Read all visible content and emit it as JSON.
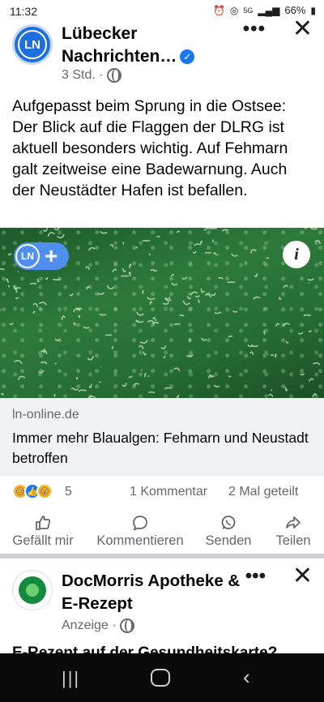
{
  "status_bar": {
    "time": "11:32",
    "network": "5G",
    "battery": "66%"
  },
  "post": {
    "avatar_text": "LN",
    "page_name": "Lübecker Nachrichten…",
    "time_ago": "3 Std. ·",
    "more_label": "•••",
    "close_label": "✕",
    "text": "Aufgepasst beim Sprung in die Ostsee: Der Blick auf die Flaggen der DLRG ist aktuell besonders wichtig. Auf Fehmarn galt zeitweise eine Badewarnung. Auch der Neustädter Hafen ist befallen.",
    "image_badge_text": "LN",
    "image_badge_plus": "+",
    "image_info_label": "i",
    "link_domain": "ln-online.de",
    "link_title": "Immer mehr Blaualgen: Fehmarn und Neustadt betroffen",
    "reaction_count": "5",
    "comments": "1 Kommentar",
    "shares": "2 Mal geteilt"
  },
  "actions": {
    "like": "Gefällt mir",
    "comment": "Kommentieren",
    "send": "Senden",
    "share": "Teilen"
  },
  "ad": {
    "name": "DocMorris Apotheke & E-Rezept",
    "meta": "Anzeige ·",
    "more_label": "•••",
    "close_label": "✕",
    "text_preview": "E-Rezept auf der Gesundheitskarte?"
  },
  "colors": {
    "accent": "#1877f2",
    "secondary_text": "#65676b",
    "link_bg": "#f0f2f5"
  }
}
